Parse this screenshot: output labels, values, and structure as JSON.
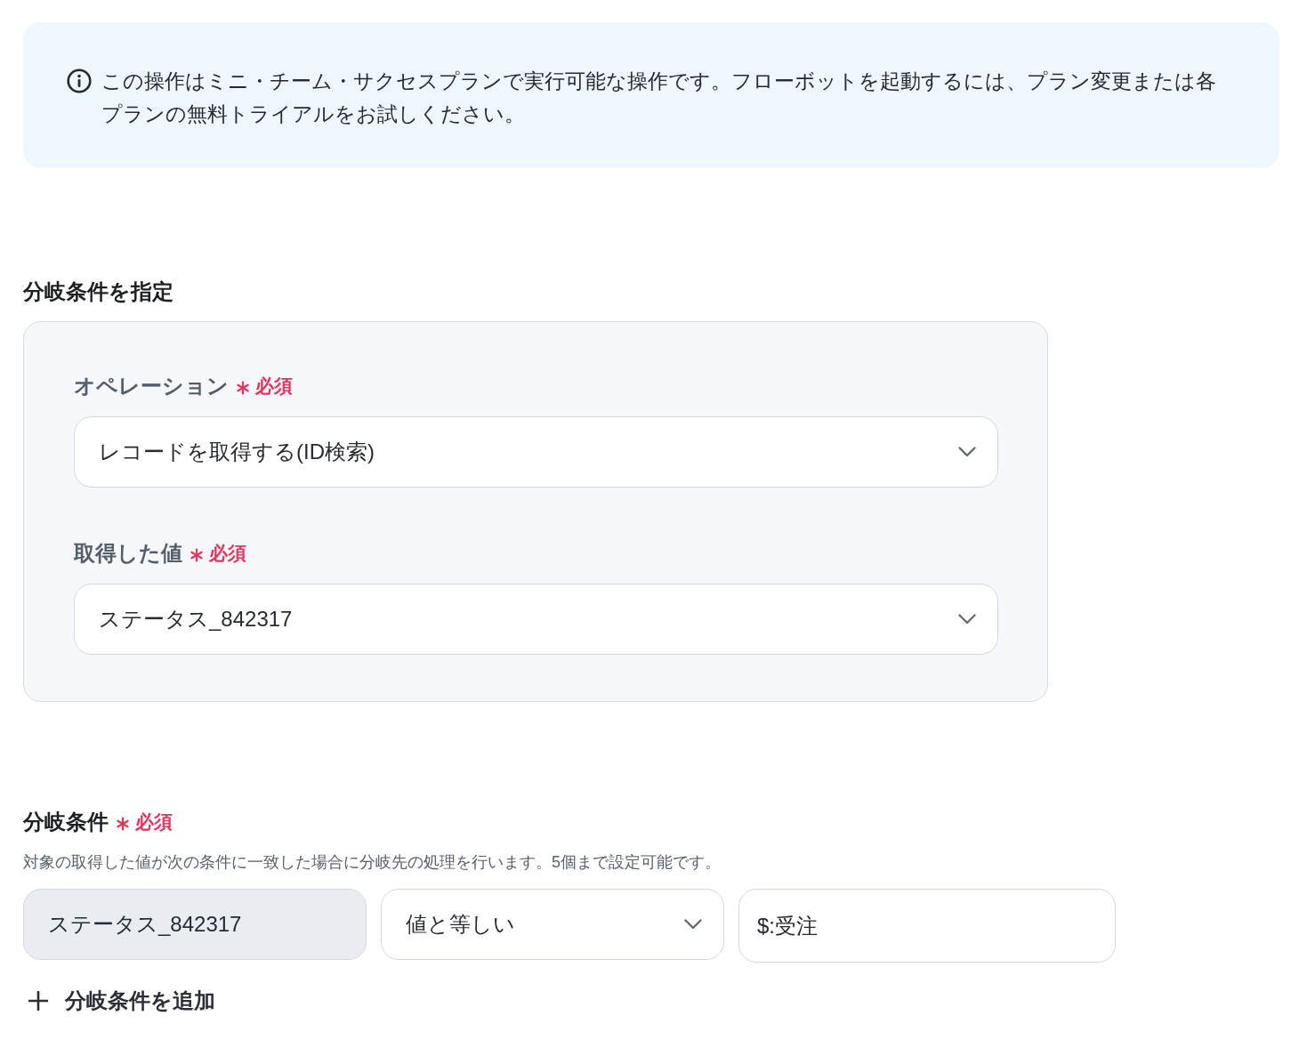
{
  "alert": {
    "kind": "info",
    "message": "この操作はミニ・チーム・サクセスプランで実行可能な操作です。フローボットを起動するには、プラン変更または各プランの無料トライアルをお試しください。"
  },
  "branch_settings": {
    "title": "分岐条件を指定",
    "fields": [
      {
        "label": "オペレーション",
        "required_mark": "必須",
        "kind": "select",
        "value": "レコードを取得する(ID検索)"
      },
      {
        "label": "取得した値",
        "required_mark": "必須",
        "kind": "select",
        "value": "ステータス_842317"
      }
    ]
  },
  "branch_conditions": {
    "title": "分岐条件",
    "required_mark": "必須",
    "description": "対象の取得した値が次の条件に一致した場合に分岐先の処理を行います。5個まで設定可能です。",
    "conditions": [
      {
        "fields": [
          {
            "kind": "readonly",
            "value": "ステータス_842317"
          },
          {
            "kind": "select",
            "value": "値と等しい"
          },
          {
            "kind": "input",
            "value": "$:受注"
          }
        ]
      }
    ],
    "add_button": "分岐条件を追加"
  }
}
